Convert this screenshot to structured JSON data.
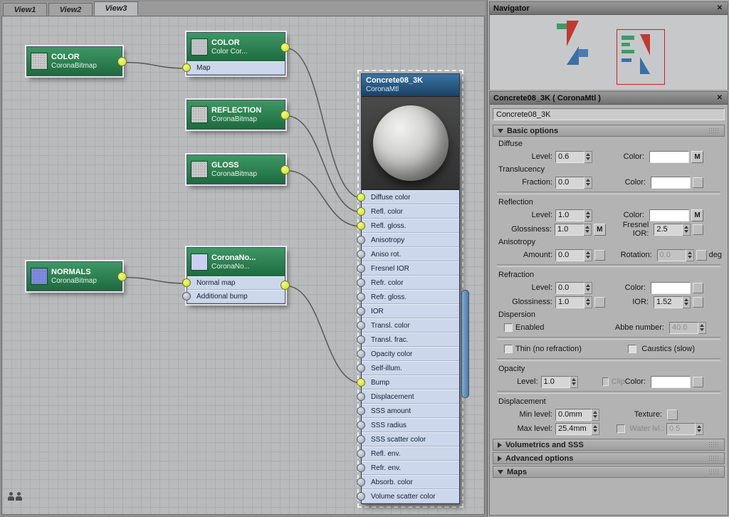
{
  "window": {
    "tabs": [
      {
        "label": "View1",
        "active": false
      },
      {
        "label": "View2",
        "active": false
      },
      {
        "label": "View3",
        "active": true
      }
    ]
  },
  "navigator": {
    "title": "Navigator",
    "close_glyph": "✕"
  },
  "graph": {
    "nodes": {
      "color_bitmap": {
        "title": "COLOR",
        "subtitle": "CoronaBitmap"
      },
      "color_correct": {
        "title": "COLOR",
        "subtitle": "Color Cor...",
        "slots": [
          {
            "label": "Map",
            "connected": true
          }
        ]
      },
      "reflection_bitmap": {
        "title": "REFLECTION",
        "subtitle": "CoronaBitmap"
      },
      "gloss_bitmap": {
        "title": "GLOSS",
        "subtitle": "CoronaBitmap"
      },
      "normals_bitmap": {
        "title": "NORMALS",
        "subtitle": "CoronaBitmap"
      },
      "corona_normal": {
        "title": "CoronaNo...",
        "subtitle": "CoronaNo...",
        "slots": [
          {
            "label": "Normal map",
            "connected": true
          },
          {
            "label": "Additional bump",
            "connected": false
          }
        ]
      },
      "material": {
        "title": "Concrete08_3K",
        "subtitle": "CoronaMtl",
        "slots": [
          {
            "label": "Diffuse color",
            "connected": true
          },
          {
            "label": "Refl. color",
            "connected": true
          },
          {
            "label": "Refl. gloss.",
            "connected": true
          },
          {
            "label": "Anisotropy",
            "connected": false
          },
          {
            "label": "Aniso rot.",
            "connected": false
          },
          {
            "label": "Fresnel IOR",
            "connected": false
          },
          {
            "label": "Refr. color",
            "connected": false
          },
          {
            "label": "Refr. gloss.",
            "connected": false
          },
          {
            "label": "IOR",
            "connected": false
          },
          {
            "label": "Transl. color",
            "connected": false
          },
          {
            "label": "Transl. frac.",
            "connected": false
          },
          {
            "label": "Opacity color",
            "connected": false
          },
          {
            "label": "Self-illum.",
            "connected": false
          },
          {
            "label": "Bump",
            "connected": true
          },
          {
            "label": "Displacement",
            "connected": false
          },
          {
            "label": "SSS amount",
            "connected": false
          },
          {
            "label": "SSS radius",
            "connected": false
          },
          {
            "label": "SSS scatter color",
            "connected": false
          },
          {
            "label": "Refl. env.",
            "connected": false
          },
          {
            "label": "Refr. env.",
            "connected": false
          },
          {
            "label": "Absorb. color",
            "connected": false
          },
          {
            "label": "Volume scatter color",
            "connected": false
          }
        ]
      }
    },
    "wires": [
      {
        "from": "out-color-bitmap",
        "to": "cc-slot-0"
      },
      {
        "from": "out-color-correct",
        "to": "mat-slot-0"
      },
      {
        "from": "out-reflection",
        "to": "mat-slot-1"
      },
      {
        "from": "out-gloss",
        "to": "mat-slot-2"
      },
      {
        "from": "out-normals",
        "to": "cn-slot-0"
      },
      {
        "from": "out-corona-normal",
        "to": "mat-slot-13"
      }
    ]
  },
  "params": {
    "panel_title": "Concrete08_3K  ( CoronaMtl )",
    "close_glyph": "✕",
    "material_name": "Concrete08_3K",
    "basic": {
      "title": "Basic options",
      "diffuse_group": "Diffuse",
      "translucency_group": "Translucency",
      "reflection_group": "Reflection",
      "anisotropy_group": "Anisotropy",
      "refraction_group": "Refraction",
      "dispersion_group": "Dispersion",
      "opacity_group": "Opacity",
      "displacement_group": "Displacement",
      "level_label": "Level:",
      "color_label": "Color:",
      "fraction_label": "Fraction:",
      "glossiness_label": "Glossiness:",
      "fresnel_label": "Fresnel IOR:",
      "amount_label": "Amount:",
      "rotation_label": "Rotation:",
      "deg_label": "deg",
      "ior_label": "IOR:",
      "enabled_label": "Enabled",
      "abbe_label": "Abbe number:",
      "thin_label": "Thin (no refraction)",
      "caustics_label": "Caustics (slow)",
      "clip_label": "Clip",
      "min_level_label": "Min level:",
      "max_level_label": "Max level:",
      "texture_label": "Texture:",
      "water_label": "Water lvl.:",
      "map_button": "M",
      "values": {
        "diffuse_level": "0.6",
        "translucency_fraction": "0.0",
        "reflection_level": "1.0",
        "reflection_glossiness": "1.0",
        "fresnel_ior": "2.5",
        "aniso_amount": "0.0",
        "aniso_rotation": "0.0",
        "refraction_level": "0.0",
        "refraction_glossiness": "1.0",
        "refraction_ior": "1.52",
        "abbe_number": "40.0",
        "opacity_level": "1.0",
        "displacement_min": "0.0mm",
        "displacement_max": "25.4mm",
        "water_level": "0.5"
      }
    },
    "rollouts": [
      {
        "title": "Volumetrics and SSS",
        "collapsed": true
      },
      {
        "title": "Advanced options",
        "collapsed": true
      },
      {
        "title": "Maps",
        "collapsed": false
      }
    ]
  }
}
